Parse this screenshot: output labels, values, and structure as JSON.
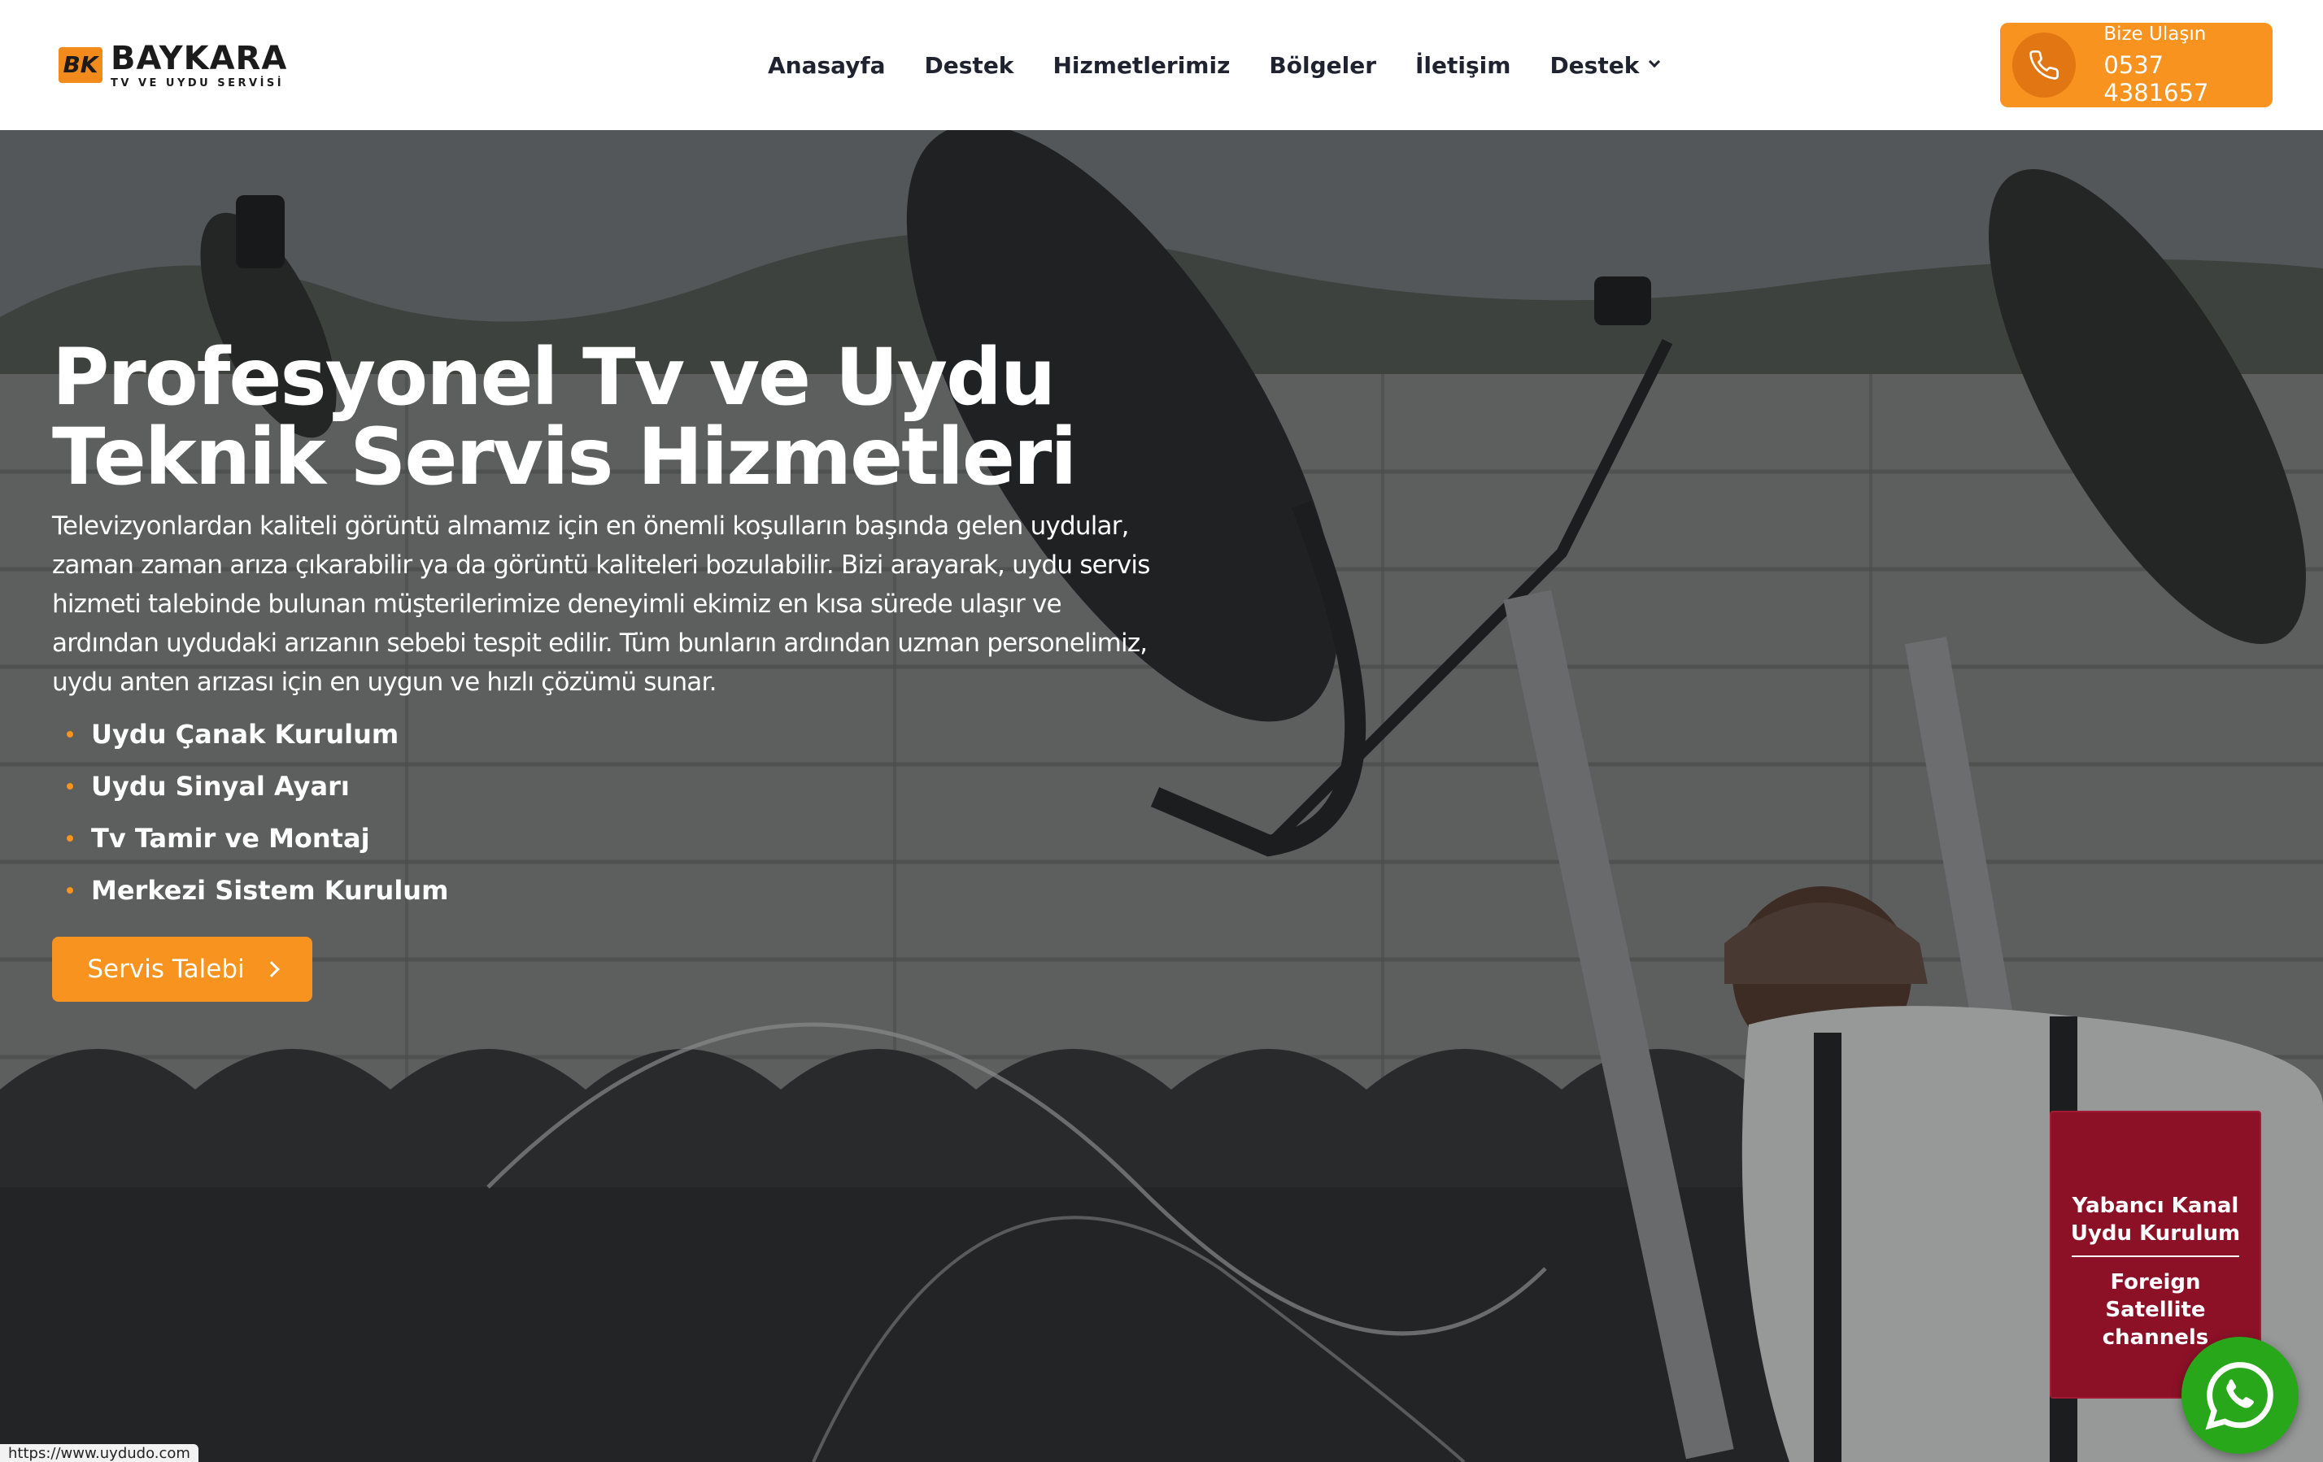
{
  "brand": {
    "mark": "BK",
    "name": "BAYKARA",
    "tagline": "TV VE UYDU SERVİSİ"
  },
  "nav": {
    "items": [
      {
        "label": "Anasayfa"
      },
      {
        "label": "Destek"
      },
      {
        "label": "Hizmetlerimiz"
      },
      {
        "label": "Bölgeler"
      },
      {
        "label": "İletişim"
      },
      {
        "label": "Destek",
        "dropdown": true
      }
    ]
  },
  "contact": {
    "label": "Bize Ulaşın",
    "phone": "0537 4381657",
    "icon": "phone-icon"
  },
  "hero": {
    "title_line1": "Profesyonel Tv ve Uydu",
    "title_line2": "Teknik Servis Hizmetleri",
    "description": "Televizyonlardan kaliteli görüntü almamız için en önemli koşulların başında gelen uydular, zaman zaman arıza çıkarabilir ya da görüntü kaliteleri bozulabilir. Bizi arayarak, uydu servis hizmeti talebinde bulunan müşterilerimize deneyimli ekimiz en kısa sürede ulaşır ve ardından uydudaki arızanın sebebi tespit edilir. Tüm bunların ardından uzman personelimiz, uydu anten arızası için en uygun ve hızlı çözümü sunar.",
    "services": [
      "Uydu Çanak Kurulum",
      "Uydu Sinyal Ayarı",
      "Tv Tamir ve Montaj",
      "Merkezi Sistem Kurulum"
    ],
    "cta_label": "Servis Talebi"
  },
  "foreign_card": {
    "title_line1": "Yabancı Kanal",
    "title_line2": "Uydu Kurulum",
    "sub_line1": "Foreign",
    "sub_line2": "Satellite",
    "sub_line3": "channels"
  },
  "status_bar": {
    "url": "https://www.uydudo.com"
  },
  "colors": {
    "accent": "#f7931e",
    "card": "#8c1127",
    "whatsapp": "#29a71a",
    "nav_text": "#1f2330"
  }
}
